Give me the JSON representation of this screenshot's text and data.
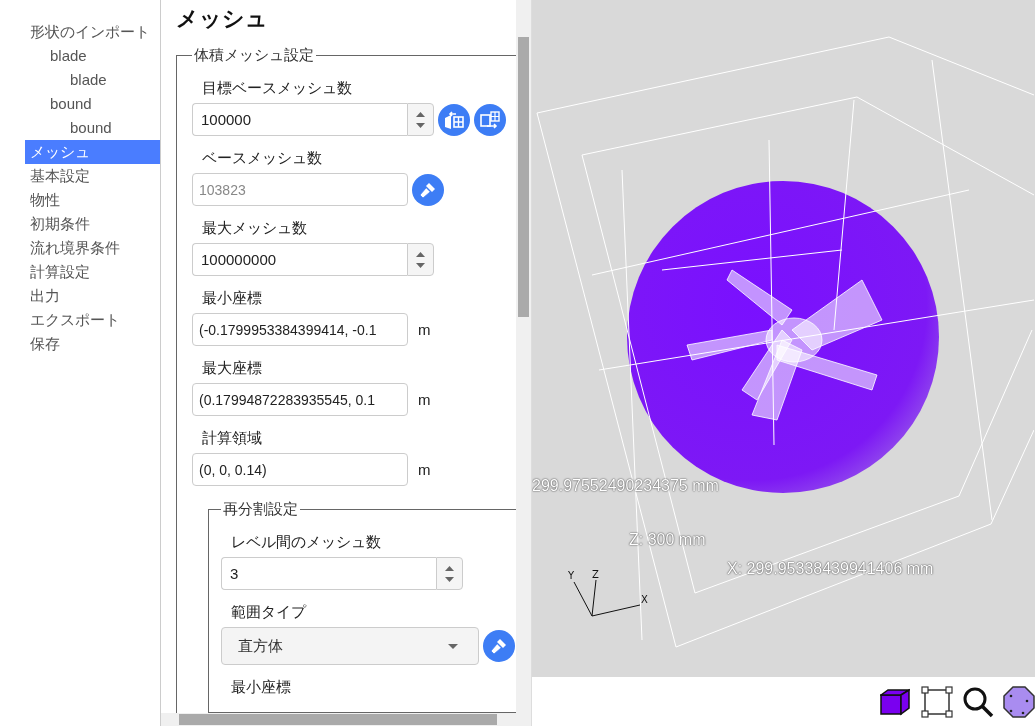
{
  "sidebar": {
    "items": [
      {
        "label": "形状のインポート",
        "selected": false,
        "children": [
          {
            "label": "blade",
            "selected": false,
            "children": [
              {
                "label": "blade",
                "selected": false
              }
            ]
          },
          {
            "label": "bound",
            "selected": false,
            "children": [
              {
                "label": "bound",
                "selected": false
              }
            ]
          }
        ]
      },
      {
        "label": "メッシュ",
        "selected": true
      },
      {
        "label": "基本設定",
        "selected": false
      },
      {
        "label": "物性",
        "selected": false
      },
      {
        "label": "初期条件",
        "selected": false
      },
      {
        "label": "流れ境界条件",
        "selected": false
      },
      {
        "label": "計算設定",
        "selected": false
      },
      {
        "label": "出力",
        "selected": false
      },
      {
        "label": "エクスポート",
        "selected": false
      },
      {
        "label": "保存",
        "selected": false
      }
    ]
  },
  "panel": {
    "title": "メッシュ",
    "sections": [
      {
        "legend": "体積メッシュ設定",
        "fields": [
          {
            "kind": "spinner",
            "label": "目標ベースメッシュ数",
            "value": "100000",
            "buttons": [
              {
                "kind": "import"
              },
              {
                "kind": "export"
              }
            ]
          },
          {
            "kind": "text",
            "label": "ベースメッシュ数",
            "value": "103823",
            "disabled": true,
            "buttons": [
              {
                "kind": "brush"
              }
            ]
          },
          {
            "kind": "spinner",
            "label": "最大メッシュ数",
            "value": "100000000"
          },
          {
            "kind": "text",
            "label": "最小座標",
            "value": "(-0.1799953384399414, -0.1",
            "disabled": false,
            "unit": "m"
          },
          {
            "kind": "text",
            "label": "最大座標",
            "value": "(0.17994872283935545, 0.1",
            "disabled": false,
            "unit": "m"
          },
          {
            "kind": "text",
            "label": "計算領域",
            "value": "(0, 0, 0.14)",
            "disabled": false,
            "unit": "m"
          }
        ],
        "subsections": [
          {
            "legend": "再分割設定",
            "fields": [
              {
                "kind": "spinner",
                "label": "レベル間のメッシュ数",
                "value": "3"
              },
              {
                "kind": "select",
                "label": "範囲タイプ",
                "value": "直方体",
                "disabled": false,
                "buttons": [
                  {
                    "kind": "brush"
                  }
                ]
              },
              {
                "kind": "label",
                "label": "最小座標"
              }
            ]
          }
        ]
      }
    ]
  },
  "viewer": {
    "dimension_labels": [
      "299.97552490234375 mm",
      "Z: 300 mm",
      "X: 299.95338439941406 mm"
    ],
    "axes": [
      "Y",
      "Z",
      "X"
    ],
    "toolbar": [
      {
        "kind": "solid"
      },
      {
        "kind": "bounds"
      },
      {
        "kind": "zoom"
      },
      {
        "kind": "points"
      }
    ]
  }
}
